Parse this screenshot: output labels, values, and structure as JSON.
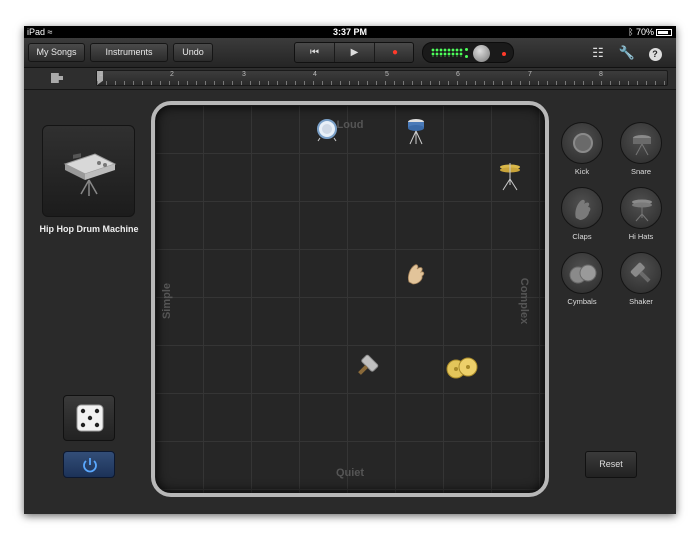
{
  "status_bar": {
    "device": "iPad",
    "time": "3:37 PM",
    "battery": "70%"
  },
  "toolbar": {
    "my_songs": "My Songs",
    "instruments": "Instruments",
    "undo": "Undo"
  },
  "ruler": {
    "bars": [
      "1",
      "2",
      "3",
      "4",
      "5",
      "6",
      "7",
      "8"
    ]
  },
  "instrument": {
    "name": "Hip Hop Drum Machine"
  },
  "pad": {
    "top_label": "Loud",
    "bottom_label": "Quiet",
    "left_label": "Simple",
    "right_label": "Complex"
  },
  "kit_buttons": [
    {
      "label": "Kick",
      "icon": "kick-drum-icon"
    },
    {
      "label": "Snare",
      "icon": "snare-drum-icon"
    },
    {
      "label": "Claps",
      "icon": "clap-icon"
    },
    {
      "label": "Hi Hats",
      "icon": "hi-hat-icon"
    },
    {
      "label": "Cymbals",
      "icon": "cymbals-icon"
    },
    {
      "label": "Shaker",
      "icon": "shaker-icon"
    }
  ],
  "reset_label": "Reset",
  "colors": {
    "accent_blue": "#3a8cff",
    "meter_green": "#4dff5a",
    "record_red": "#ff3a2a"
  }
}
